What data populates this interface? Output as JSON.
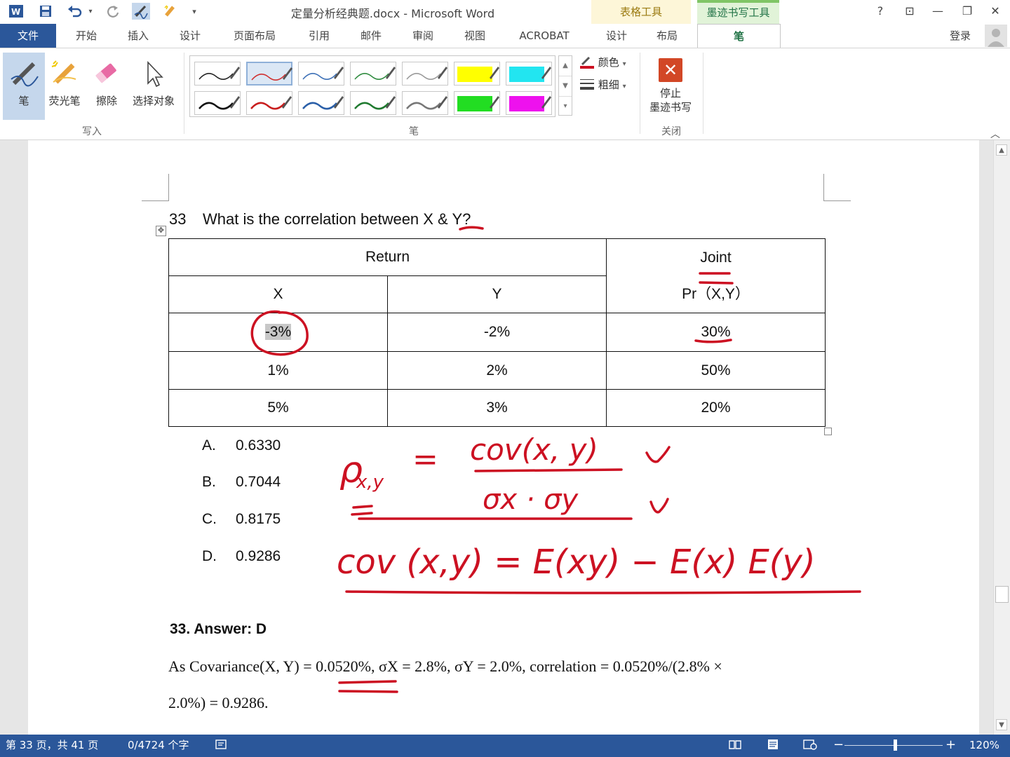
{
  "window": {
    "title": "定量分析经典题.docx - Microsoft Word",
    "help": "?",
    "ribbon_display": "⊡",
    "minimize": "—",
    "restore": "❐",
    "close": "✕"
  },
  "quick_access": {
    "app_icon": "word-icon",
    "save": "save-icon",
    "undo": "undo-icon",
    "redo": "redo-icon",
    "ink": "ink-pen-icon",
    "highlighter": "highlighter-icon",
    "customize": "customize-qat-icon"
  },
  "context_tabs": {
    "table_tools": "表格工具",
    "ink_tools": "墨迹书写工具"
  },
  "tabs": [
    "文件",
    "开始",
    "插入",
    "设计",
    "页面布局",
    "引用",
    "邮件",
    "审阅",
    "视图",
    "ACROBAT",
    "设计",
    "布局",
    "笔"
  ],
  "account": {
    "login": "登录"
  },
  "ribbon": {
    "write_buttons": [
      {
        "label": "笔",
        "icon": "pen-icon"
      },
      {
        "label": "荧光笔",
        "icon": "highlighter-icon"
      },
      {
        "label": "擦除",
        "icon": "eraser-icon"
      },
      {
        "label": "选择对象",
        "icon": "select-cursor-icon"
      }
    ],
    "group_write": "写入",
    "group_pens": "笔",
    "group_close": "关闭",
    "color_label": "颜色",
    "thickness_label": "粗细",
    "stop_label_1": "停止",
    "stop_label_2": "墨迹书写",
    "pens": [
      {
        "color": "#222222",
        "kind": "pen"
      },
      {
        "color": "#d03030",
        "kind": "pen"
      },
      {
        "color": "#3b6fb6",
        "kind": "pen"
      },
      {
        "color": "#2e8b3e",
        "kind": "pen"
      },
      {
        "color": "#999999",
        "kind": "pen"
      },
      {
        "color": "#ffff00",
        "kind": "highlighter"
      },
      {
        "color": "#22e5f0",
        "kind": "highlighter"
      },
      {
        "color": "#111111",
        "kind": "pen"
      },
      {
        "color": "#c81e1e",
        "kind": "pen"
      },
      {
        "color": "#2a5fa8",
        "kind": "pen"
      },
      {
        "color": "#1f7a2f",
        "kind": "pen"
      },
      {
        "color": "#777777",
        "kind": "pen"
      },
      {
        "color": "#22dd22",
        "kind": "highlighter"
      },
      {
        "color": "#ee11ee",
        "kind": "highlighter"
      }
    ],
    "selected_pen": 1
  },
  "document": {
    "question_number": "33",
    "question_text": "What is the correlation between X & Y?",
    "table": {
      "header_return": "Return",
      "header_joint": "Joint",
      "col_x": "X",
      "col_y": "Y",
      "col_pr": "Pr（X,Y）",
      "rows": [
        [
          "-3%",
          "-2%",
          "30%"
        ],
        [
          "1%",
          "2%",
          "50%"
        ],
        [
          "5%",
          "3%",
          "20%"
        ]
      ]
    },
    "options": [
      {
        "letter": "A.",
        "value": "0.6330"
      },
      {
        "letter": "B.",
        "value": "0.7044"
      },
      {
        "letter": "C.",
        "value": "0.8175"
      },
      {
        "letter": "D.",
        "value": "0.9286"
      }
    ],
    "answer": "33.  Answer: D",
    "explanation_1": "As Covariance(X, Y) = 0.0520%, σX = 2.8%, σY = 2.0%, correlation = 0.0520%/(2.8% ×",
    "explanation_2": "2.0%) = 0.9286.",
    "ink_color": "#cc1122",
    "ink_formula_1": "ρx,y = cov(x, y) / σx · σy",
    "ink_formula_2": "cov (x,y) = E(xy) − E(x) E(y)"
  },
  "status": {
    "page": "第 33 页，共 41 页",
    "words": "0/4724 个字",
    "zoom": "120%",
    "zoom_out": "−",
    "zoom_in": "+"
  }
}
